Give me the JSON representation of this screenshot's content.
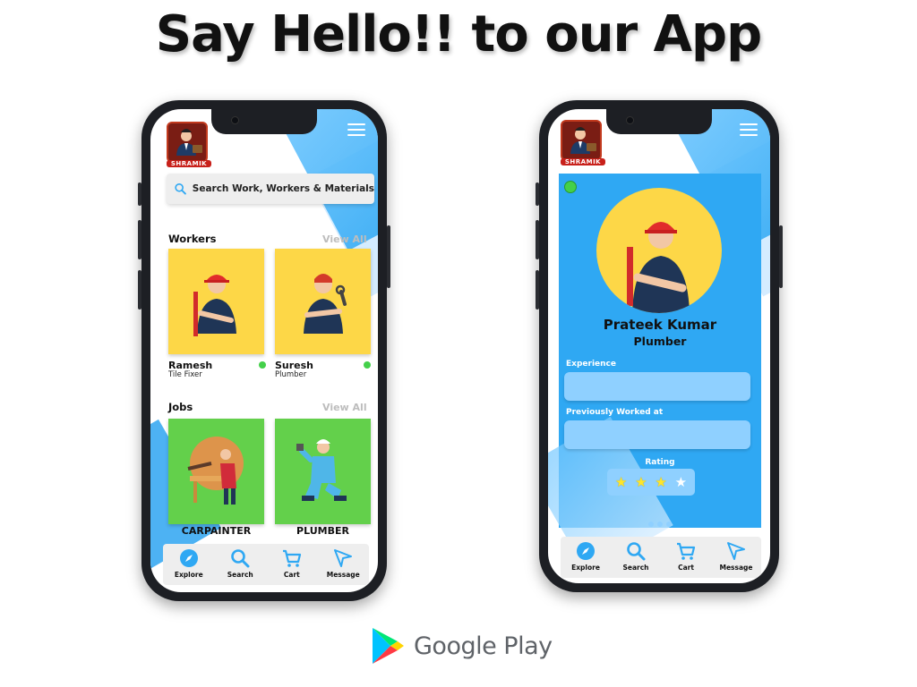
{
  "headline": "Say Hello!! to our App",
  "brand": {
    "logo_text": "SHRAMIK",
    "store_name": "Google Play"
  },
  "colors": {
    "accent_blue": "#2fa8f3",
    "card_yellow": "#fdd747",
    "card_green": "#63d04b",
    "online_green": "#44d04a"
  },
  "home": {
    "search_placeholder": "Search Work, Workers & Materials",
    "workers_title": "Workers",
    "workers_view_all": "View All",
    "workers": [
      {
        "name": "Ramesh",
        "role": "Tile Fixer",
        "online": true
      },
      {
        "name": "Suresh",
        "role": "Plumber",
        "online": true
      }
    ],
    "jobs_title": "Jobs",
    "jobs_view_all": "View All",
    "jobs": [
      {
        "label": "CARPAINTER"
      },
      {
        "label": "PLUMBER"
      }
    ]
  },
  "profile": {
    "name": "Prateek Kumar",
    "role": "Plumber",
    "experience_label": "Experience",
    "experience_value": "",
    "previously_worked_label": "Previously Worked at",
    "previously_worked_value": "",
    "rating_label": "Rating",
    "rating": {
      "value": 3,
      "max": 4
    },
    "pager": {
      "current": 1,
      "total": 3
    }
  },
  "nav": {
    "items": [
      {
        "label": "Explore",
        "icon": "compass-icon"
      },
      {
        "label": "Search",
        "icon": "search-icon"
      },
      {
        "label": "Cart",
        "icon": "cart-icon"
      },
      {
        "label": "Message",
        "icon": "send-icon"
      }
    ]
  }
}
